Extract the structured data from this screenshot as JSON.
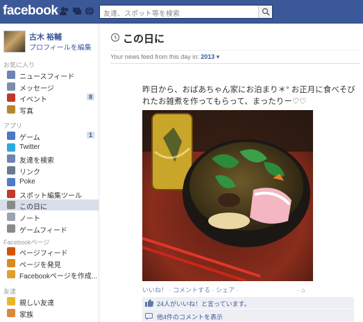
{
  "header": {
    "logo": "facebook",
    "search_placeholder": "友達、スポット等を検索"
  },
  "profile": {
    "name": "古木 裕輔",
    "edit_label": "プロフィールを編集"
  },
  "sidebar": {
    "favorites_title": "お気に入り",
    "favorites": [
      {
        "label": "ニュースフィード",
        "icon": "news-feed-icon",
        "color": "#6d84b4"
      },
      {
        "label": "メッセージ",
        "icon": "messages-icon",
        "color": "#7d8ea8"
      },
      {
        "label": "イベント",
        "icon": "events-icon",
        "color": "#c0392b",
        "count": "8"
      },
      {
        "label": "写真",
        "icon": "photos-icon",
        "color": "#b8862e"
      }
    ],
    "apps_title": "アプリ",
    "apps": [
      {
        "label": "ゲーム",
        "icon": "games-icon",
        "color": "#4b79c2",
        "count": "1"
      },
      {
        "label": "Twitter",
        "icon": "twitter-icon",
        "color": "#2fa8e0"
      },
      {
        "label": "友達を検索",
        "icon": "find-friends-icon",
        "color": "#6d84b4"
      },
      {
        "label": "リンク",
        "icon": "links-icon",
        "color": "#6b7a8f"
      },
      {
        "label": "Poke",
        "icon": "poke-icon",
        "color": "#4f7bc8"
      },
      {
        "label": "スポット編集ツール",
        "icon": "place-editor-icon",
        "color": "#c0392b"
      },
      {
        "label": "この日に",
        "icon": "clock-icon",
        "color": "#8a8a8a",
        "selected": true
      },
      {
        "label": "ノート",
        "icon": "notes-icon",
        "color": "#9aa3b0"
      },
      {
        "label": "ゲームフィード",
        "icon": "game-feed-icon",
        "color": "#8a8a8a"
      }
    ],
    "pages_title": "Facebookページ",
    "pages": [
      {
        "label": "ページフィード",
        "icon": "pages-feed-icon",
        "color": "#d35400"
      },
      {
        "label": "ページを発見",
        "icon": "discover-pages-icon",
        "color": "#d98b1e"
      },
      {
        "label": "Facebookページを作成...",
        "icon": "create-page-icon",
        "color": "#e0a030"
      }
    ],
    "friends_title": "友達",
    "friends": [
      {
        "label": "親しい友達",
        "icon": "star-icon",
        "color": "#e5b82a"
      },
      {
        "label": "家族",
        "icon": "family-icon",
        "color": "#d88a3a"
      }
    ]
  },
  "main": {
    "title": "この日に",
    "filter_prefix": "Your news feed from this day in:",
    "filter_year": "2013",
    "story_text": "昨日から、おばあちゃん家にお泊まり＊° お正月に食べそびれたお雑煮を作ってもらって、まったりー♡♡",
    "actions": "いいね！ · コメントする · シェア ·",
    "likes_text": "24人がいいね！と言っています。",
    "comments_text": "他4件のコメントを表示"
  }
}
